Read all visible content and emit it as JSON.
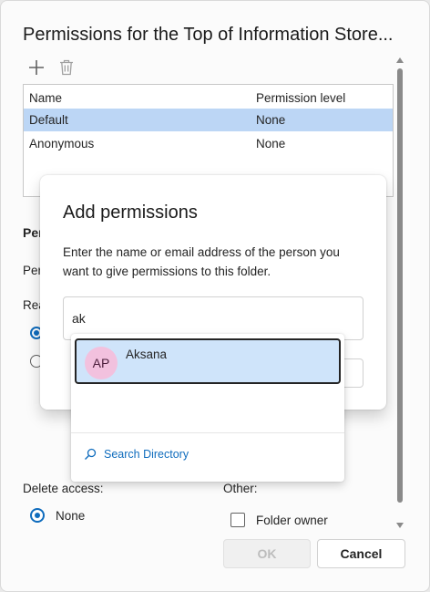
{
  "window": {
    "title": "Permissions for the Top of Information Store..."
  },
  "toolbar": {
    "add_icon": "plus-icon",
    "delete_icon": "trash-icon"
  },
  "permissions_table": {
    "headers": [
      "Name",
      "Permission level"
    ],
    "rows": [
      {
        "name": "Default",
        "level": "None",
        "selected": true
      },
      {
        "name": "Anonymous",
        "level": "None",
        "selected": false
      }
    ]
  },
  "background_fragments": {
    "perm_heading": "Per",
    "per_line": "Per",
    "read_line": "Rea"
  },
  "delete_access": {
    "label": "Delete access:",
    "selected_option": "None"
  },
  "other": {
    "label": "Other:",
    "folder_owner_label": "Folder owner",
    "folder_owner_checked": false
  },
  "footer": {
    "ok_label": "OK",
    "cancel_label": "Cancel"
  },
  "add_permissions_dialog": {
    "title": "Add permissions",
    "description": "Enter the name or email address of the person you want to give permissions to this folder.",
    "search_value": "ak",
    "suggestions": [
      {
        "initials": "AP",
        "name": "Aksana",
        "avatar_color": "#f2c1de"
      }
    ],
    "search_directory_label": "Search Directory"
  },
  "colors": {
    "accent": "#0f6cbd",
    "selected_row": "#bcd6f5",
    "suggestion_highlight": "#cfe4fa"
  }
}
